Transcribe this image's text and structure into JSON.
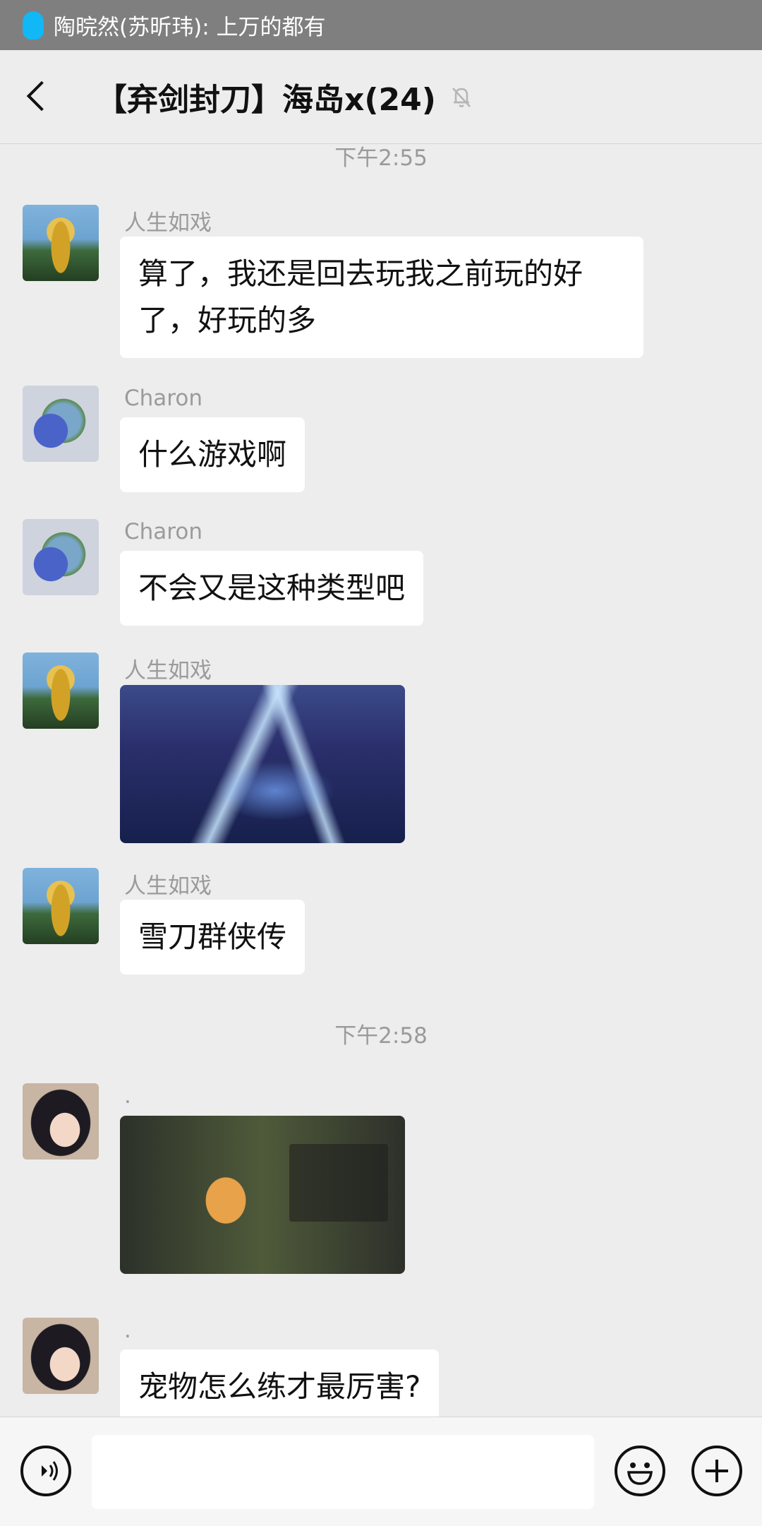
{
  "notification": {
    "app_icon": "qq-penguin-icon",
    "text": "陶晥然(苏昕玮): 上万的都有"
  },
  "header": {
    "back_icon": "chevron-left-icon",
    "title": "【弃剑封刀】海岛x(24)",
    "mute_icon": "bell-off-icon"
  },
  "messages": [
    {
      "type": "time",
      "text": "下午2:55"
    },
    {
      "type": "text",
      "sender": "人生如戏",
      "avatar": "golden-buddha",
      "text": "算了，我还是回去玩我之前玩的好了，好玩的多"
    },
    {
      "type": "text",
      "sender": "Charon",
      "avatar": "stitch-globe",
      "text": "什么游戏啊"
    },
    {
      "type": "text",
      "sender": "Charon",
      "avatar": "stitch-globe",
      "text": "不会又是这种类型吧"
    },
    {
      "type": "image",
      "sender": "人生如戏",
      "avatar": "golden-buddha",
      "image": "game-battle-screenshot"
    },
    {
      "type": "text",
      "sender": "人生如戏",
      "avatar": "golden-buddha",
      "text": "雪刀群侠传"
    },
    {
      "type": "time",
      "text": "下午2:58"
    },
    {
      "type": "image",
      "sender": ".",
      "avatar": "anime-girl",
      "image": "game-pet-screenshot"
    },
    {
      "type": "text",
      "sender": ".",
      "avatar": "anime-girl",
      "text": "宠物怎么练才最厉害?"
    }
  ],
  "input_bar": {
    "voice_icon": "voice-icon",
    "input_value": "",
    "emoji_icon": "emoji-icon",
    "plus_icon": "plus-icon"
  },
  "colors": {
    "background": "#ededed",
    "bubble": "#ffffff",
    "notification_bar": "#7f7f7f",
    "qq_icon": "#12b7f5",
    "meta_text": "#9b9b9b"
  }
}
